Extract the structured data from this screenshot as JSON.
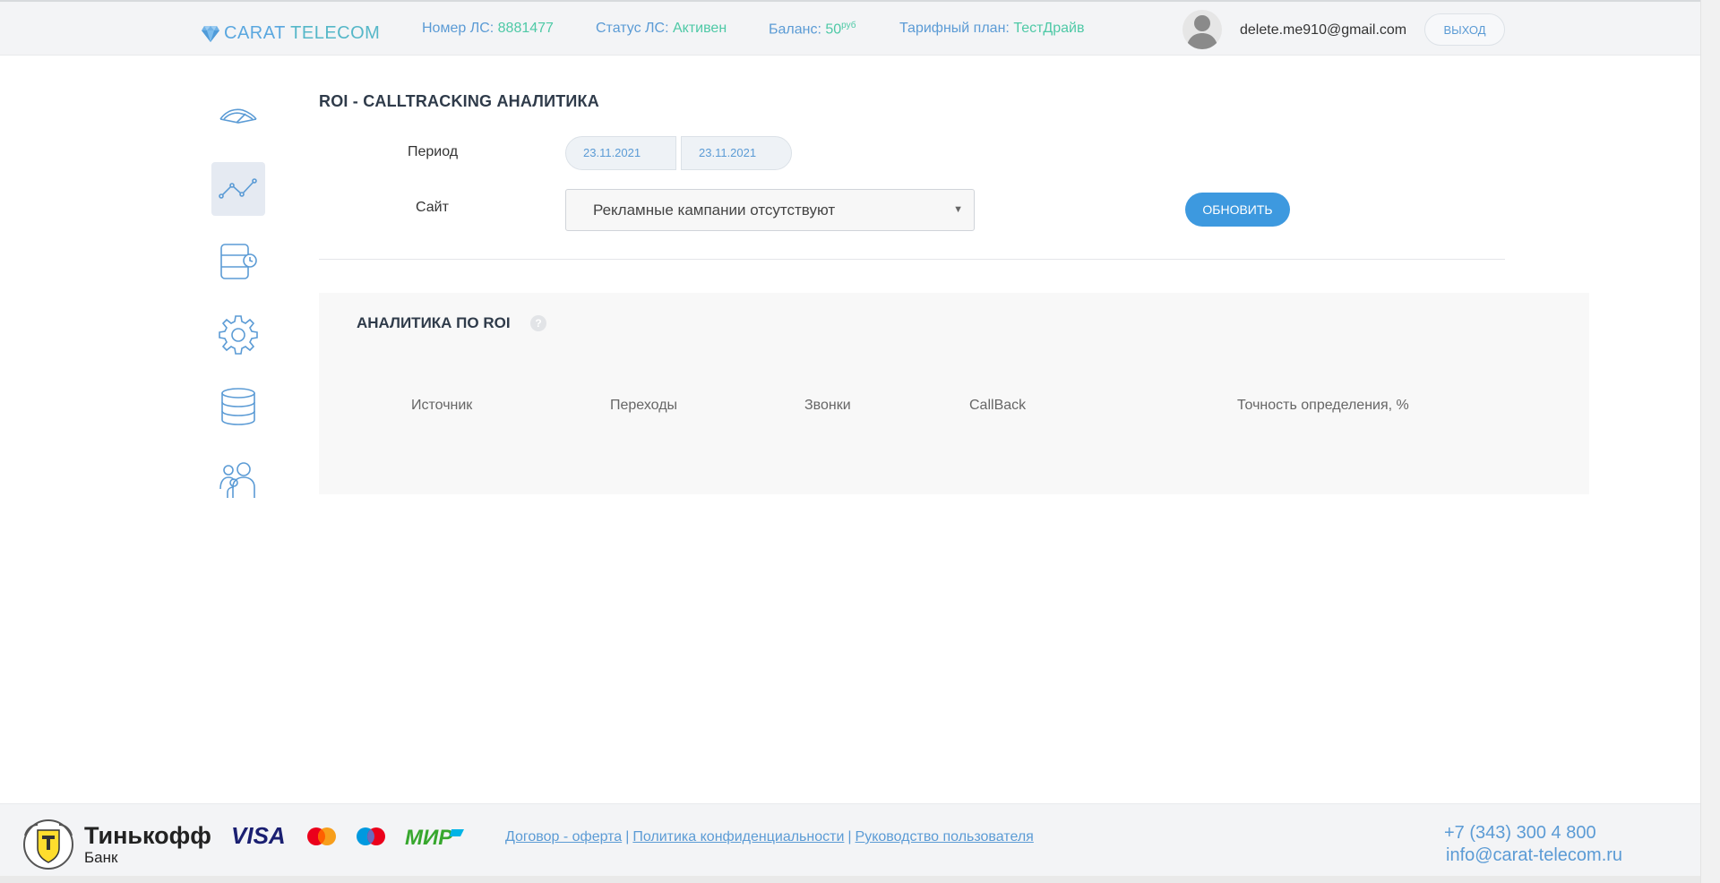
{
  "header": {
    "logo_part1": "CARAT",
    "logo_part2": "TELECOM",
    "account_label": "Номер ЛС:",
    "account_value": "8881477",
    "status_label": "Статус ЛС:",
    "status_value": "Активен",
    "balance_label": "Баланс:",
    "balance_value": "50",
    "balance_unit": "руб",
    "plan_label": "Тарифный план:",
    "plan_value": "ТестДрайв",
    "email": "delete.me910@gmail.com",
    "logout_label": "ВЫХОД"
  },
  "sidebar": {
    "items": [
      {
        "icon": "dashboard-gauge-icon",
        "active": false
      },
      {
        "icon": "analytics-chart-icon",
        "active": true
      },
      {
        "icon": "call-history-icon",
        "active": false
      },
      {
        "icon": "settings-gear-icon",
        "active": false
      },
      {
        "icon": "database-icon",
        "active": false
      },
      {
        "icon": "users-icon",
        "active": false
      }
    ]
  },
  "main": {
    "title": "ROI - CALLTRACKING АНАЛИТИКА",
    "period_label": "Период",
    "date_from": "23.11.2021",
    "date_to": "23.11.2021",
    "site_label": "Сайт",
    "site_value": "Рекламные кампании отсутствуют",
    "refresh_label": "ОБНОВИТЬ"
  },
  "panel": {
    "title": "АНАЛИТИКА ПО ROI",
    "help": "?",
    "columns": [
      "Источник",
      "Переходы",
      "Звонки",
      "CallBack",
      "Точность определения, %"
    ]
  },
  "footer": {
    "bank_name": "Тинькофф",
    "bank_sub": "Банк",
    "payment_methods": [
      "VISA",
      "Mastercard",
      "Maestro",
      "МИР"
    ],
    "links": [
      "Договор - оферта",
      "Политика конфиденциальности",
      "Руководство пользователя"
    ],
    "phone": "+7 (343) 300 4 800",
    "email": "info@carat-telecom.ru"
  },
  "colors": {
    "accent": "#5b9bd5",
    "value_green": "#4ec9a6",
    "button_blue": "#3d99df"
  }
}
